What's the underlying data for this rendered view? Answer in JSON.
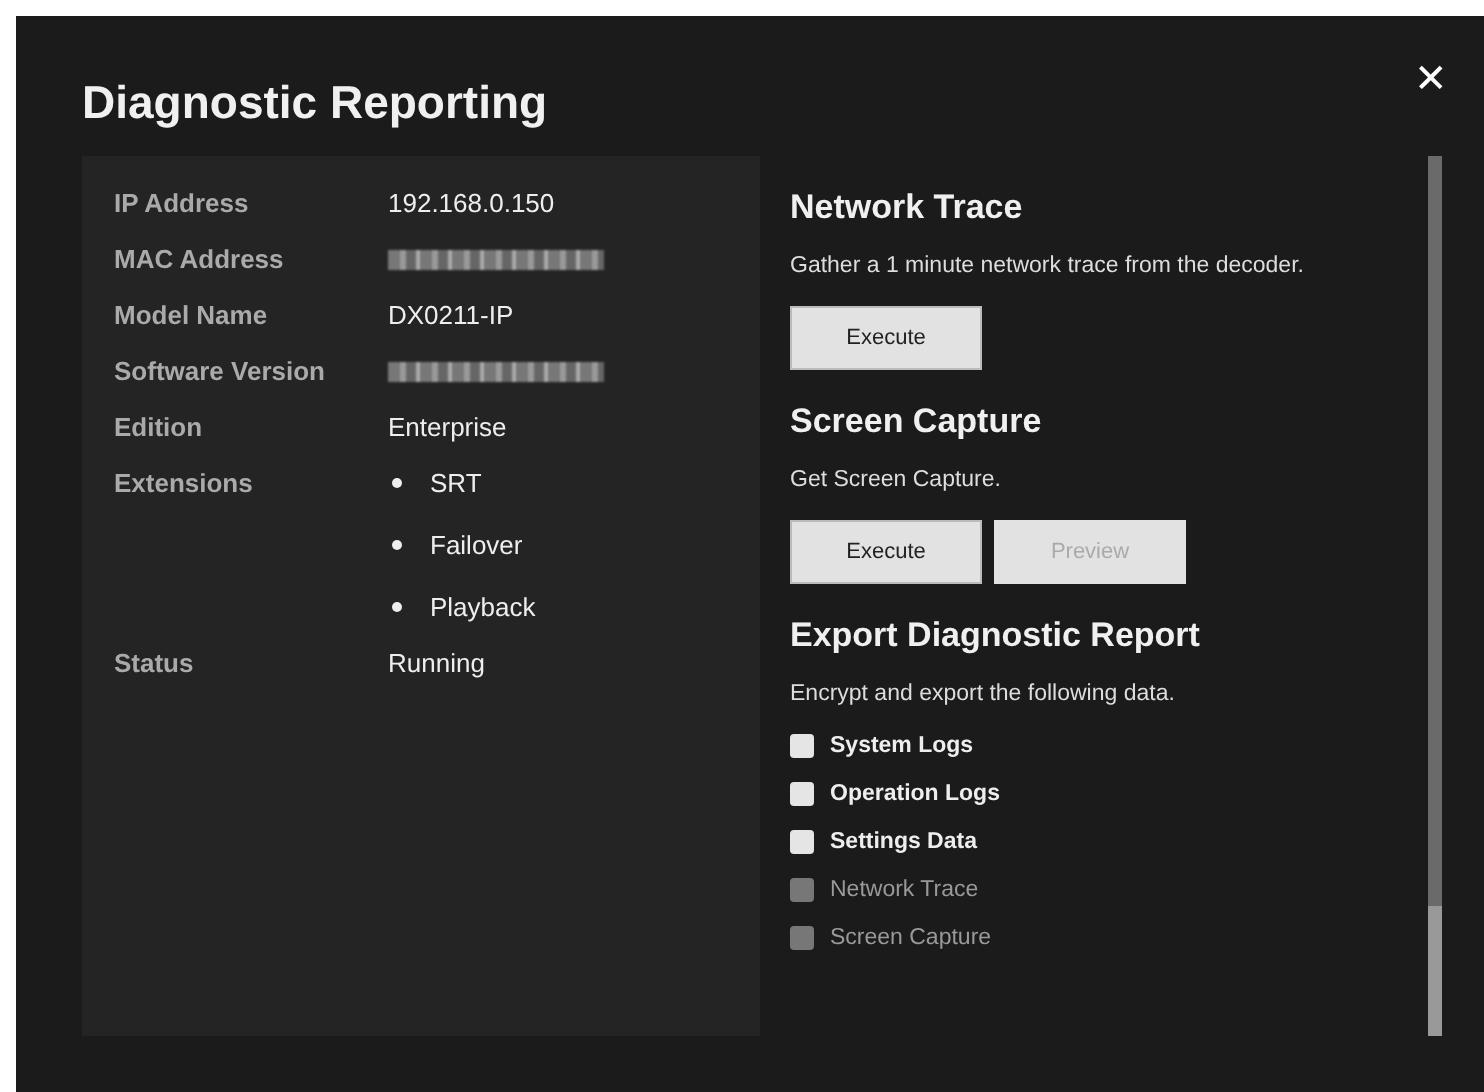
{
  "dialog": {
    "title": "Diagnostic Reporting",
    "close": "✕"
  },
  "info": [
    {
      "label": "IP Address",
      "value": "192.168.0.150",
      "redacted": false
    },
    {
      "label": "MAC Address",
      "redacted": true
    },
    {
      "label": "Model Name",
      "value": "DX0211-IP",
      "redacted": false
    },
    {
      "label": "Software Version",
      "redacted": true
    },
    {
      "label": "Edition",
      "value": "Enterprise",
      "redacted": false
    },
    {
      "label": "Extensions",
      "list": [
        "SRT",
        "Failover",
        "Playback"
      ]
    },
    {
      "label": "Status",
      "value": "Running",
      "redacted": false
    }
  ],
  "sections": [
    {
      "title": "Network Trace",
      "description": "Gather a 1 minute network trace from the decoder.",
      "buttons": [
        {
          "label": "Execute",
          "disabled": false
        }
      ]
    },
    {
      "title": "Screen Capture",
      "description": "Get Screen Capture.",
      "buttons": [
        {
          "label": "Execute",
          "disabled": false
        },
        {
          "label": "Preview",
          "disabled": true
        }
      ]
    },
    {
      "title": "Export Diagnostic Report",
      "description": "Encrypt and export the following data.",
      "checkboxes": [
        {
          "label": "System Logs",
          "checked": false,
          "disabled": false
        },
        {
          "label": "Operation Logs",
          "checked": false,
          "disabled": false
        },
        {
          "label": "Settings Data",
          "checked": false,
          "disabled": false
        },
        {
          "label": "Network Trace",
          "checked": false,
          "disabled": true
        },
        {
          "label": "Screen Capture",
          "checked": false,
          "disabled": true
        }
      ]
    }
  ]
}
